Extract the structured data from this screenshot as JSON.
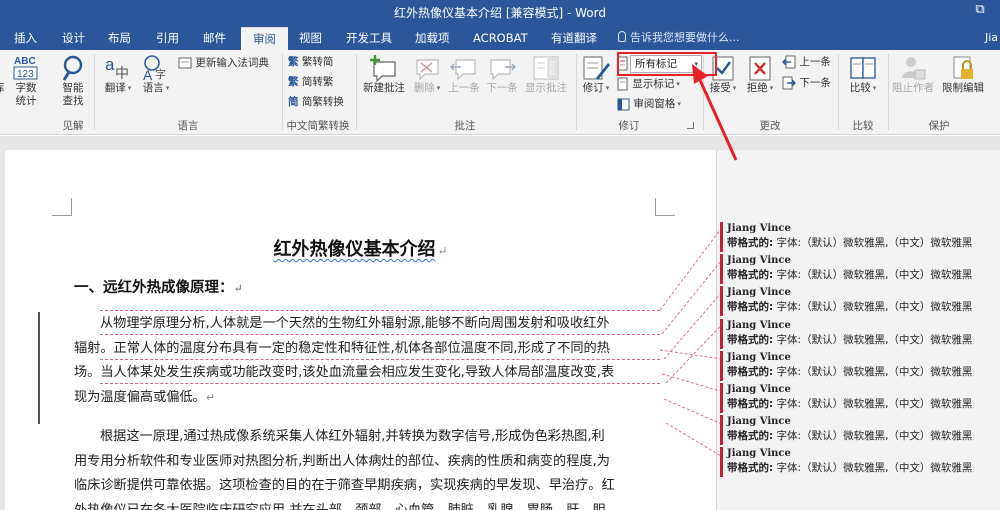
{
  "window": {
    "title": "红外热像仪基本介绍 [兼容模式] - Word",
    "restore_glyph": "⧉"
  },
  "tabs": {
    "insert": "插入",
    "design": "设计",
    "layout": "布局",
    "references": "引用",
    "mailings": "邮件",
    "review": "审阅",
    "view": "视图",
    "developer": "开发工具",
    "addins": "加载项",
    "acrobat": "ACROBAT",
    "youdao": "有道翻译",
    "tell_me": "告诉我您想要做什么...",
    "user": "Jia"
  },
  "ribbon": {
    "proofing": {
      "partial_label": "库",
      "word_count": [
        "字数",
        "统计"
      ],
      "group": "见解",
      "smart_lookup": [
        "智能",
        "查找"
      ]
    },
    "language": {
      "translate": "翻译",
      "language": "语言",
      "update_ime": "更新输入法词典",
      "group": "语言"
    },
    "chinese_conversion": {
      "to_simplified": "繁转简",
      "to_traditional": "简转繁",
      "conversion": "简繁转换",
      "group": "中文简繁转换"
    },
    "comments": {
      "new_comment": "新建批注",
      "delete": "删除",
      "previous": "上一条",
      "next": "下一条",
      "show_comments": "显示批注",
      "group": "批注"
    },
    "tracking": {
      "track_changes": "修订",
      "markup_dropdown": "所有标记",
      "show_markup": "显示标记",
      "reviewing_pane": "审阅窗格",
      "group": "修订"
    },
    "changes": {
      "accept": "接受",
      "reject": "拒绝",
      "previous": "上一条",
      "next": "下一条",
      "group": "更改"
    },
    "compare": {
      "compare": "比较",
      "group": "比较"
    },
    "protect": {
      "block_authors": "阻止作者",
      "restrict_editing": "限制编辑",
      "group": "保护"
    }
  },
  "document": {
    "title": "红外热像仪基本介绍",
    "heading1": "一、远红外热成像原理：",
    "para1_lines": [
      "从物理学原理分析,人体就是一个天然的生物红外辐射源,能够不断向周围发射和吸收红外",
      "辐射。正常人体的温度分布具有一定的稳定性和特征性,机体各部位温度不同,形成了不同的热",
      "场。当人体某处发生疾病或功能改变时,该处血流量会相应发生变化,导致人体局部温度改变,表",
      "现为温度偏高或偏低。"
    ],
    "para2_lines": [
      "根据这一原理,通过热成像系统采集人体红外辐射,并转换为数字信号,形成伪色彩热图,利",
      "用专用分析软件和专业医师对热图分析,判断出人体病灶的部位、疾病的性质和病变的程度,为",
      "临床诊断提供可靠依据。这项检查的目的在于筛查早期疾病，实现疾病的早发现、早治疗。红",
      "外热像仪已在各大医院临床研究应用,并在头部、颈部、心血管、肺脏、乳腺、胃肠、肝、胆、"
    ],
    "para_mark": "↵"
  },
  "balloons": {
    "author": "Jiang Vince",
    "label": "带格式的:",
    "detail": "字体:（默认）微软雅黑,（中文）微软雅黑",
    "count": 8
  },
  "colors": {
    "title_bar": "#2b579a",
    "ribbon": "#f3f3f3",
    "highlight": "#e8202a",
    "revision": "#c0203a"
  }
}
